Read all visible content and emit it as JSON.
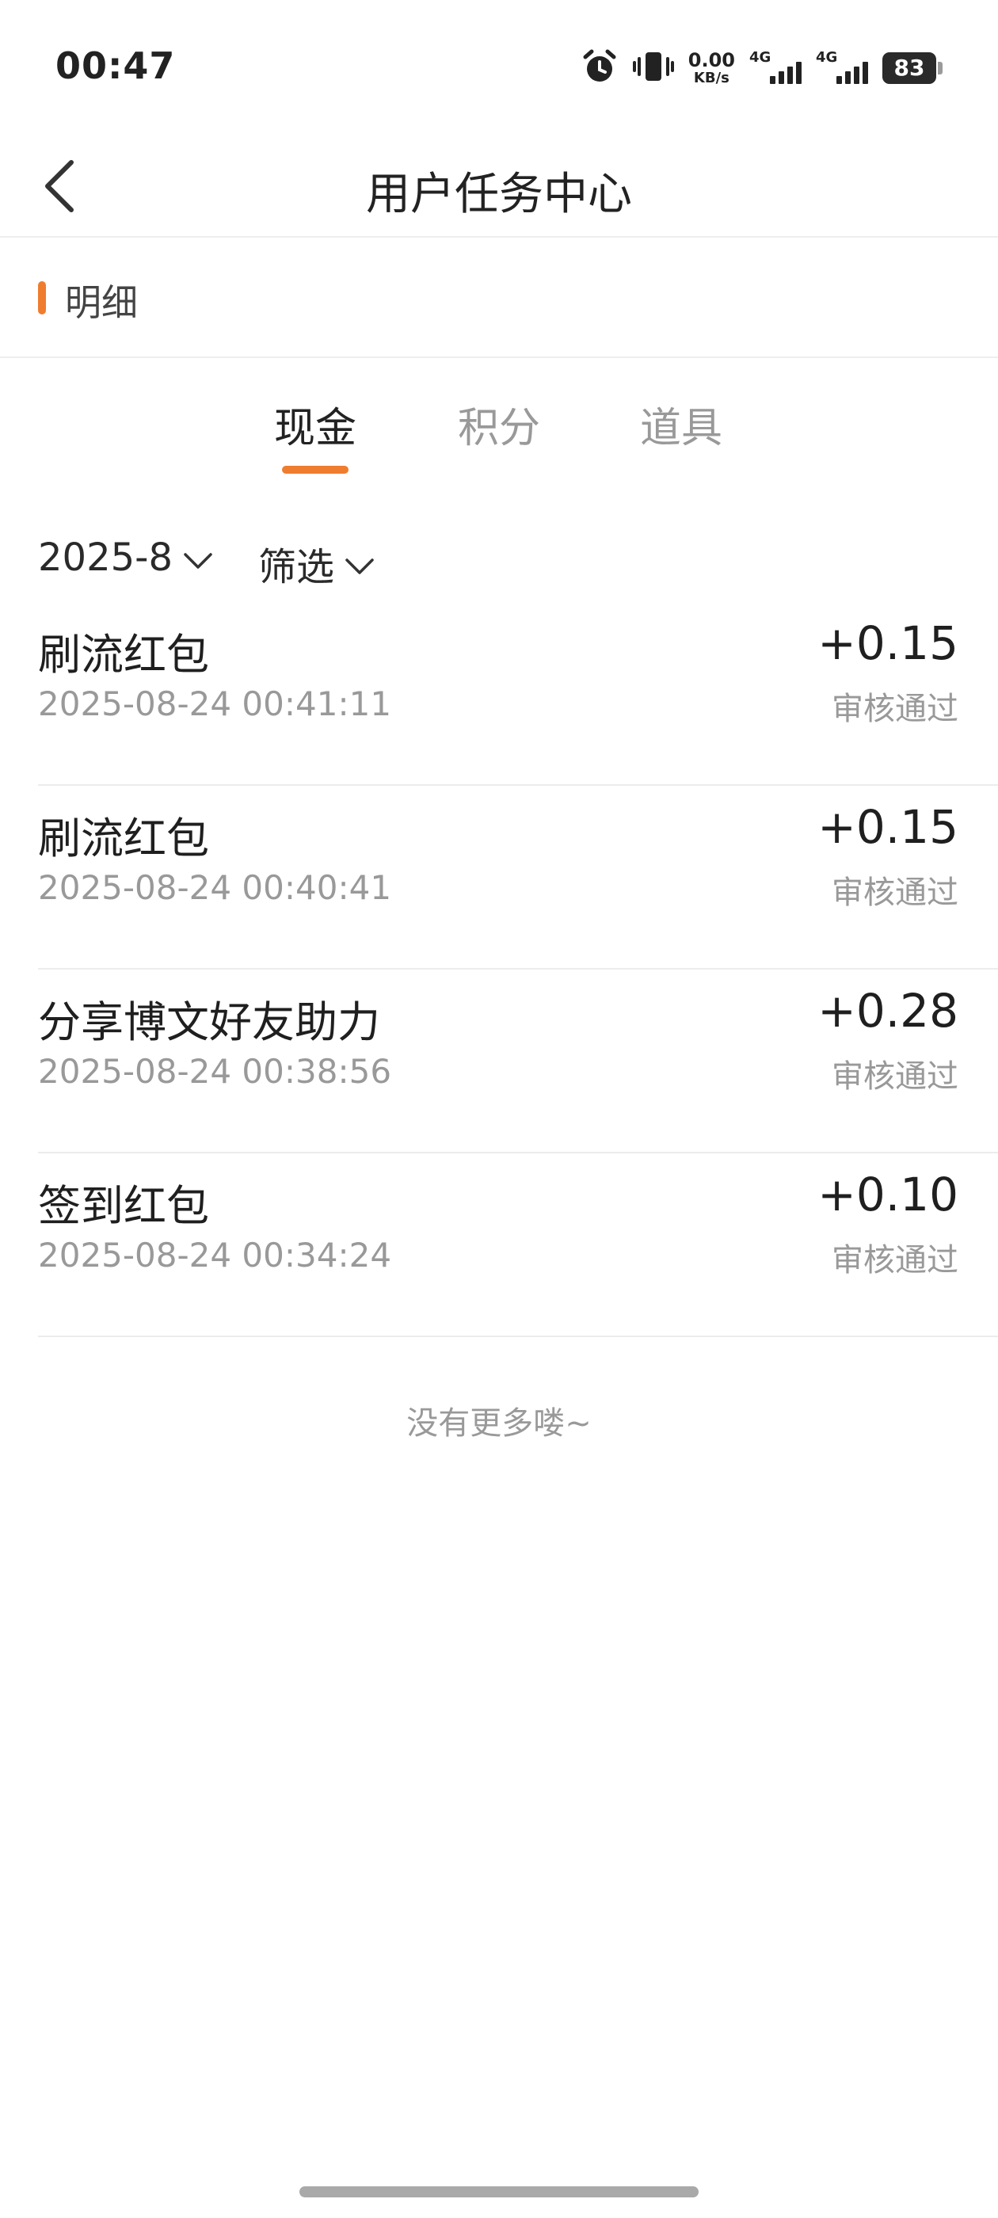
{
  "status_bar": {
    "time": "00:47",
    "icons": [
      "alarm-icon",
      "vibrate-icon"
    ],
    "net_speed_value": "0.00",
    "net_speed_unit": "KB/s",
    "signal1_label": "4G",
    "signal2_label": "4G",
    "battery": "83"
  },
  "nav": {
    "title": "用户任务中心",
    "back_icon": "chevron-left-icon"
  },
  "section": {
    "title": "明细",
    "accent_color": "#ef7d2f"
  },
  "tabs": [
    {
      "label": "现金",
      "active": true
    },
    {
      "label": "积分",
      "active": false
    },
    {
      "label": "道具",
      "active": false
    }
  ],
  "filters": {
    "month": "2025-8",
    "filter_label": "筛选"
  },
  "records": [
    {
      "title": "刷流红包",
      "time": "2025-08-24 00:41:11",
      "amount": "+0.15",
      "status": "审核通过"
    },
    {
      "title": "刷流红包",
      "time": "2025-08-24 00:40:41",
      "amount": "+0.15",
      "status": "审核通过"
    },
    {
      "title": "分享博文好友助力",
      "time": "2025-08-24 00:38:56",
      "amount": "+0.28",
      "status": "审核通过"
    },
    {
      "title": "签到红包",
      "time": "2025-08-24 00:34:24",
      "amount": "+0.10",
      "status": "审核通过"
    }
  ],
  "footer": {
    "no_more": "没有更多喽~"
  }
}
